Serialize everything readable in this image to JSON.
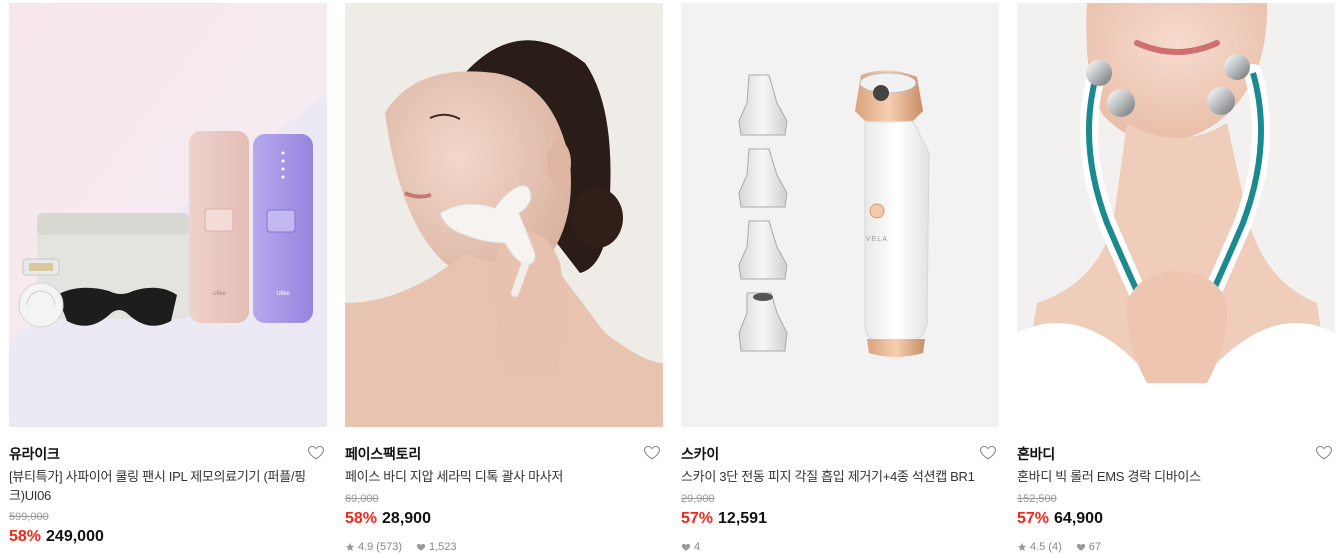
{
  "products": [
    {
      "brand": "유라이크",
      "name": "[뷰티특가] 사파이어 쿨링 팬시 IPL 제모의료기기 (퍼플/핑크)UI06",
      "original_price": "599,000",
      "discount": "58%",
      "price": "249,000",
      "rating": "",
      "reviews": "",
      "likes": "",
      "device_labels": [
        "Ulike",
        "Ulike"
      ]
    },
    {
      "brand": "페이스팩토리",
      "name": "페이스 바디 지압 세라믹 디톡 괄사 마사저",
      "original_price": "69,000",
      "discount": "58%",
      "price": "28,900",
      "rating": "4.9",
      "reviews": "(573)",
      "likes": "1,523"
    },
    {
      "brand": "스카이",
      "name": "스카이 3단 전동 피지 각질 흡입 제거기+4종 석션캡 BR1",
      "original_price": "29,900",
      "discount": "57%",
      "price": "12,591",
      "rating": "",
      "reviews": "",
      "likes": "4",
      "device_label": "VELA"
    },
    {
      "brand": "혼바디",
      "name": "혼바디 빅 롤러 EMS 경락 디바이스",
      "original_price": "152,500",
      "discount": "57%",
      "price": "64,900",
      "rating": "4.5",
      "reviews": "(4)",
      "likes": "67"
    }
  ],
  "icons": {
    "wishlist": "heart-outline-icon",
    "rating": "star-icon",
    "likes": "heart-filled-icon"
  },
  "colors": {
    "discount": "#f4271c",
    "card_bg_1": "#f6e9ea",
    "card_bg_3": "#f2f2f2"
  }
}
